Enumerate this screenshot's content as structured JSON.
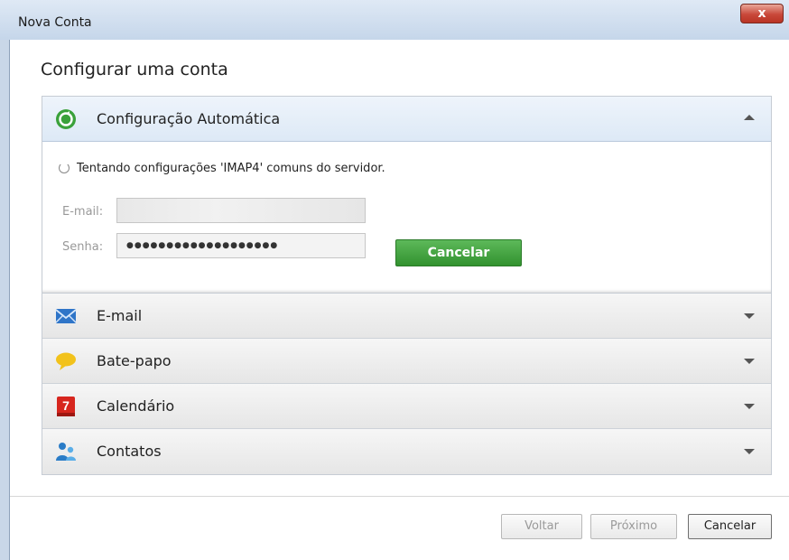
{
  "window": {
    "title": "Nova Conta",
    "close_label": "x"
  },
  "heading": "Configurar uma conta",
  "panels": [
    {
      "label": "Configuração Automática",
      "icon": "auto-config-icon",
      "expanded": true
    },
    {
      "label": "E-mail",
      "icon": "envelope-icon",
      "expanded": false
    },
    {
      "label": "Bate-papo",
      "icon": "chat-bubble-icon",
      "expanded": false
    },
    {
      "label": "Calendário",
      "icon": "calendar-icon",
      "expanded": false
    },
    {
      "label": "Contatos",
      "icon": "contacts-icon",
      "expanded": false
    }
  ],
  "auto_config": {
    "status": "Tentando configurações 'IMAP4' comuns do servidor.",
    "email_label": "E-mail:",
    "email_value": "",
    "password_label": "Senha:",
    "password_value": "●●●●●●●●●●●●●●●●●●●",
    "cancel_label": "Cancelar"
  },
  "calendar_day": "7",
  "footer": {
    "back_label": "Voltar",
    "next_label": "Próximo",
    "cancel_label": "Cancelar"
  },
  "colors": {
    "accent_green": "#3a9b36",
    "title_bar": "#c5d6ea",
    "close_red": "#c9483a"
  }
}
